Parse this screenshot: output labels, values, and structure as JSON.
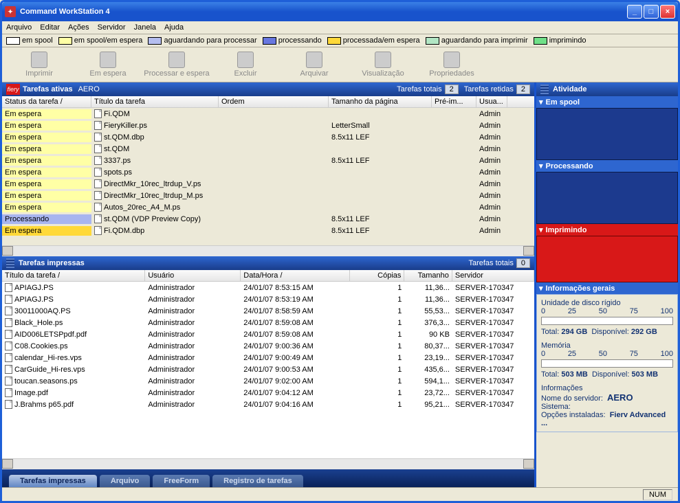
{
  "title": "Command WorkStation 4",
  "menu": [
    "Arquivo",
    "Editar",
    "Ações",
    "Servidor",
    "Janela",
    "Ajuda"
  ],
  "legend": [
    {
      "color": "#ffffff",
      "label": "em spool"
    },
    {
      "color": "#ffffa5",
      "label": "em spool/em espera"
    },
    {
      "color": "#b5bef0",
      "label": "aguardando para processar"
    },
    {
      "color": "#6877e0",
      "label": "processando"
    },
    {
      "color": "#ffd938",
      "label": "processada/em espera"
    },
    {
      "color": "#b2e6c4",
      "label": "aguardando para imprimir"
    },
    {
      "color": "#70e088",
      "label": "imprimindo"
    }
  ],
  "toolbar": [
    "Imprimir",
    "Em espera",
    "Processar e espera",
    "Excluir",
    "Arquivar",
    "Visualização",
    "Propriedades"
  ],
  "active_panel": {
    "title": "Tarefas ativas",
    "server": "AERO",
    "totals_label": "Tarefas totais",
    "totals": "2",
    "held_label": "Tarefas retidas",
    "held": "2",
    "cols": [
      "Status da tarefa /",
      "Título da tarefa",
      "Ordem",
      "Tamanho da página",
      "Pré-im...",
      "Usua..."
    ],
    "rows": [
      {
        "status": "Em espera",
        "bg": "#ffffa5",
        "title": "Fi.QDM",
        "size": "",
        "user": "Admin"
      },
      {
        "status": "Em espera",
        "bg": "#ffffa5",
        "title": "FieryKiller.ps",
        "size": "LetterSmall",
        "user": "Admin"
      },
      {
        "status": "Em espera",
        "bg": "#ffffa5",
        "title": "st.QDM.dbp",
        "size": "8.5x11 LEF",
        "user": "Admin"
      },
      {
        "status": "Em espera",
        "bg": "#ffffa5",
        "title": "st.QDM",
        "size": "",
        "user": "Admin"
      },
      {
        "status": "Em espera",
        "bg": "#ffffa5",
        "title": "3337.ps",
        "size": "8.5x11 LEF",
        "user": "Admin"
      },
      {
        "status": "Em espera",
        "bg": "#ffffa5",
        "title": "spots.ps",
        "size": "",
        "user": "Admin"
      },
      {
        "status": "Em espera",
        "bg": "#ffffa5",
        "title": "DirectMkr_10rec_ltrdup_V.ps",
        "size": "",
        "user": "Admin"
      },
      {
        "status": "Em espera",
        "bg": "#ffffa5",
        "title": "DirectMkr_10rec_ltrdup_M.ps",
        "size": "",
        "user": "Admin"
      },
      {
        "status": "Em espera",
        "bg": "#ffffa5",
        "title": "Autos_20rec_A4_M.ps",
        "size": "",
        "user": "Admin"
      },
      {
        "status": "Processando",
        "bg": "#a8b5ef",
        "title": "st.QDM (VDP Preview Copy)",
        "size": "8.5x11 LEF",
        "user": "Admin"
      },
      {
        "status": "Em espera",
        "bg": "#ffd938",
        "title": "Fi.QDM.dbp",
        "size": "8.5x11 LEF",
        "user": "Admin"
      }
    ]
  },
  "printed_panel": {
    "title": "Tarefas impressas",
    "totals_label": "Tarefas totais",
    "totals": "0",
    "cols": [
      "Título da tarefa /",
      "Usuário",
      "Data/Hora /",
      "Cópias",
      "Tamanho",
      "Servidor"
    ],
    "rows": [
      {
        "t": "APIAGJ.PS",
        "u": "Administrador",
        "d": "24/01/07  8:53:15 AM",
        "c": "1",
        "s": "11,36...",
        "v": "SERVER-170347"
      },
      {
        "t": "APIAGJ.PS",
        "u": "Administrador",
        "d": "24/01/07  8:53:19 AM",
        "c": "1",
        "s": "11,36...",
        "v": "SERVER-170347"
      },
      {
        "t": "30011000AQ.PS",
        "u": "Administrador",
        "d": "24/01/07  8:58:59 AM",
        "c": "1",
        "s": "55,53...",
        "v": "SERVER-170347"
      },
      {
        "t": "Black_Hole.ps",
        "u": "Administrador",
        "d": "24/01/07  8:59:08 AM",
        "c": "1",
        "s": "376,3...",
        "v": "SERVER-170347"
      },
      {
        "t": "AID006LETSPpdf.pdf",
        "u": "Administrador",
        "d": "24/01/07  8:59:08 AM",
        "c": "1",
        "s": "90 KB",
        "v": "SERVER-170347"
      },
      {
        "t": "C08.Cookies.ps",
        "u": "Administrador",
        "d": "24/01/07  9:00:36 AM",
        "c": "1",
        "s": "80,37...",
        "v": "SERVER-170347"
      },
      {
        "t": "calendar_Hi-res.vps",
        "u": "Administrador",
        "d": "24/01/07  9:00:49 AM",
        "c": "1",
        "s": "23,19...",
        "v": "SERVER-170347"
      },
      {
        "t": "CarGuide_Hi-res.vps",
        "u": "Administrador",
        "d": "24/01/07  9:00:53 AM",
        "c": "1",
        "s": "435,6...",
        "v": "SERVER-170347"
      },
      {
        "t": "toucan.seasons.ps",
        "u": "Administrador",
        "d": "24/01/07  9:02:00 AM",
        "c": "1",
        "s": "594,1...",
        "v": "SERVER-170347"
      },
      {
        "t": "Image.pdf",
        "u": "Administrador",
        "d": "24/01/07  9:04:12 AM",
        "c": "1",
        "s": "23,72...",
        "v": "SERVER-170347"
      },
      {
        "t": "J.Brahms p65.pdf",
        "u": "Administrador",
        "d": "24/01/07  9:04:16 AM",
        "c": "1",
        "s": "95,21...",
        "v": "SERVER-170347"
      }
    ]
  },
  "tabs": [
    "Tarefas impressas",
    "Arquivo",
    "FreeForm",
    "Registro de tarefas"
  ],
  "right": {
    "activity": "Atividade",
    "spool": "Em spool",
    "proc": "Processando",
    "print": "Imprimindo",
    "info_title": "Informações gerais",
    "disk_label": "Unidade de disco rígido",
    "ticks": [
      "0",
      "25",
      "50",
      "75",
      "100"
    ],
    "disk_total_l": "Total:",
    "disk_total": "294 GB",
    "disk_free_l": "Disponível:",
    "disk_free": "292 GB",
    "mem_label": "Memória",
    "mem_total_l": "Total:",
    "mem_total": "503 MB",
    "mem_free_l": "Disponível:",
    "mem_free": "503 MB",
    "info_l": "Informações",
    "srv_l": "Nome do servidor:",
    "srv": "AERO",
    "sys_l": "Sistema:",
    "opt_l": "Opções instaladas:",
    "opt": "Fierv Advanced ..."
  },
  "status": "NUM"
}
